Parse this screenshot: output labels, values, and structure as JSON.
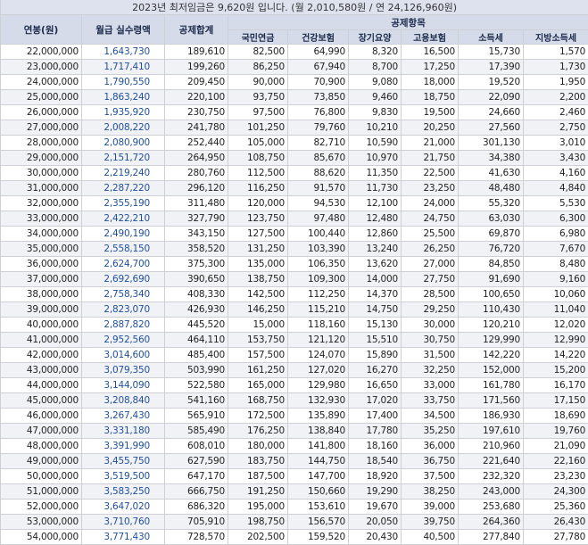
{
  "title": "2023년 최저임금은 9,620원 입니다. (월 2,010,580원 / 연 24,126,960원)",
  "headers": {
    "salary": "연봉(원)",
    "net": "월급 실수령액",
    "total_deduction": "공제합계",
    "group": "공제항목",
    "sub": [
      "국민연금",
      "건강보험",
      "장기요양",
      "고용보험",
      "소득세",
      "지방소득세"
    ]
  },
  "rows": [
    [
      "22,000,000",
      "1,643,730",
      "189,610",
      "82,500",
      "64,990",
      "8,320",
      "16,500",
      "15,730",
      "1,570"
    ],
    [
      "23,000,000",
      "1,717,410",
      "199,260",
      "86,250",
      "67,940",
      "8,700",
      "17,250",
      "17,390",
      "1,730"
    ],
    [
      "24,000,000",
      "1,790,550",
      "209,450",
      "90,000",
      "70,900",
      "9,080",
      "18,000",
      "19,520",
      "1,950"
    ],
    [
      "25,000,000",
      "1,863,240",
      "220,100",
      "93,750",
      "73,850",
      "9,460",
      "18,750",
      "22,090",
      "2,200"
    ],
    [
      "26,000,000",
      "1,935,920",
      "230,750",
      "97,500",
      "76,800",
      "9,830",
      "19,500",
      "24,660",
      "2,460"
    ],
    [
      "27,000,000",
      "2,008,220",
      "241,780",
      "101,250",
      "79,760",
      "10,210",
      "20,250",
      "27,560",
      "2,750"
    ],
    [
      "28,000,000",
      "2,080,900",
      "252,440",
      "105,000",
      "82,710",
      "10,590",
      "21,000",
      "301,130",
      "3,010"
    ],
    [
      "29,000,000",
      "2,151,720",
      "264,950",
      "108,750",
      "85,670",
      "10,970",
      "21,750",
      "34,380",
      "3,430"
    ],
    [
      "30,000,000",
      "2,219,240",
      "280,760",
      "112,500",
      "88,620",
      "11,350",
      "22,500",
      "41,630",
      "4,160"
    ],
    [
      "31,000,000",
      "2,287,220",
      "296,120",
      "116,250",
      "91,570",
      "11,730",
      "23,250",
      "48,480",
      "4,840"
    ],
    [
      "32,000,000",
      "2,355,190",
      "311,480",
      "120,000",
      "94,530",
      "12,100",
      "24,000",
      "55,320",
      "5,530"
    ],
    [
      "33,000,000",
      "2,422,210",
      "327,790",
      "123,750",
      "97,480",
      "12,480",
      "24,750",
      "63,030",
      "6,300"
    ],
    [
      "34,000,000",
      "2,490,190",
      "343,150",
      "127,500",
      "100,440",
      "12,860",
      "25,500",
      "69,870",
      "6,980"
    ],
    [
      "35,000,000",
      "2,558,150",
      "358,520",
      "131,250",
      "103,390",
      "13,240",
      "26,250",
      "76,720",
      "7,670"
    ],
    [
      "36,000,000",
      "2,624,700",
      "375,300",
      "135,000",
      "106,350",
      "13,620",
      "27,000",
      "84,850",
      "8,480"
    ],
    [
      "37,000,000",
      "2,692,690",
      "390,650",
      "138,750",
      "109,300",
      "14,000",
      "27,750",
      "91,690",
      "9,160"
    ],
    [
      "38,000,000",
      "2,758,340",
      "408,330",
      "142,500",
      "112,250",
      "14,370",
      "28,500",
      "100,650",
      "10,060"
    ],
    [
      "39,000,000",
      "2,823,070",
      "426,930",
      "146,250",
      "115,210",
      "14,750",
      "29,250",
      "110,430",
      "11,040"
    ],
    [
      "40,000,000",
      "2,887,820",
      "445,520",
      "15,000",
      "118,160",
      "15,130",
      "30,000",
      "120,210",
      "12,020"
    ],
    [
      "41,000,000",
      "2,952,560",
      "464,110",
      "153,750",
      "121,120",
      "15,510",
      "30,750",
      "129,990",
      "12,990"
    ],
    [
      "42,000,000",
      "3,014,600",
      "485,400",
      "157,500",
      "124,070",
      "15,890",
      "31,500",
      "142,220",
      "14,220"
    ],
    [
      "43,000,000",
      "3,079,350",
      "503,990",
      "161,250",
      "127,020",
      "16,270",
      "32,250",
      "152,000",
      "15,200"
    ],
    [
      "44,000,000",
      "3,144,090",
      "522,580",
      "165,000",
      "129,980",
      "16,650",
      "33,000",
      "161,780",
      "16,170"
    ],
    [
      "45,000,000",
      "3,208,840",
      "541,160",
      "168,750",
      "132,930",
      "17,020",
      "33,750",
      "171,560",
      "17,150"
    ],
    [
      "46,000,000",
      "3,267,430",
      "565,910",
      "172,500",
      "135,890",
      "17,400",
      "34,500",
      "186,930",
      "18,690"
    ],
    [
      "47,000,000",
      "3,331,180",
      "585,490",
      "176,250",
      "138,840",
      "17,780",
      "35,250",
      "197,610",
      "19,760"
    ],
    [
      "48,000,000",
      "3,391,990",
      "608,010",
      "180,000",
      "141,800",
      "18,160",
      "36,000",
      "210,960",
      "21,090"
    ],
    [
      "49,000,000",
      "3,455,750",
      "627,590",
      "183,750",
      "144,750",
      "18,540",
      "36,750",
      "221,640",
      "22,160"
    ],
    [
      "50,000,000",
      "3,519,500",
      "647,170",
      "187,500",
      "147,700",
      "18,920",
      "37,500",
      "232,320",
      "23,230"
    ],
    [
      "51,000,000",
      "3,583,250",
      "666,750",
      "191,250",
      "150,660",
      "19,290",
      "38,250",
      "243,000",
      "24,300"
    ],
    [
      "52,000,000",
      "3,647,020",
      "686,320",
      "195,000",
      "153,610",
      "19,670",
      "39,000",
      "253,680",
      "25,360"
    ],
    [
      "53,000,000",
      "3,710,760",
      "705,910",
      "198,750",
      "156,570",
      "20,050",
      "39,750",
      "264,360",
      "26,430"
    ],
    [
      "54,000,000",
      "3,771,430",
      "728,570",
      "202,500",
      "159,520",
      "20,430",
      "40,500",
      "277,840",
      "27,780"
    ]
  ]
}
